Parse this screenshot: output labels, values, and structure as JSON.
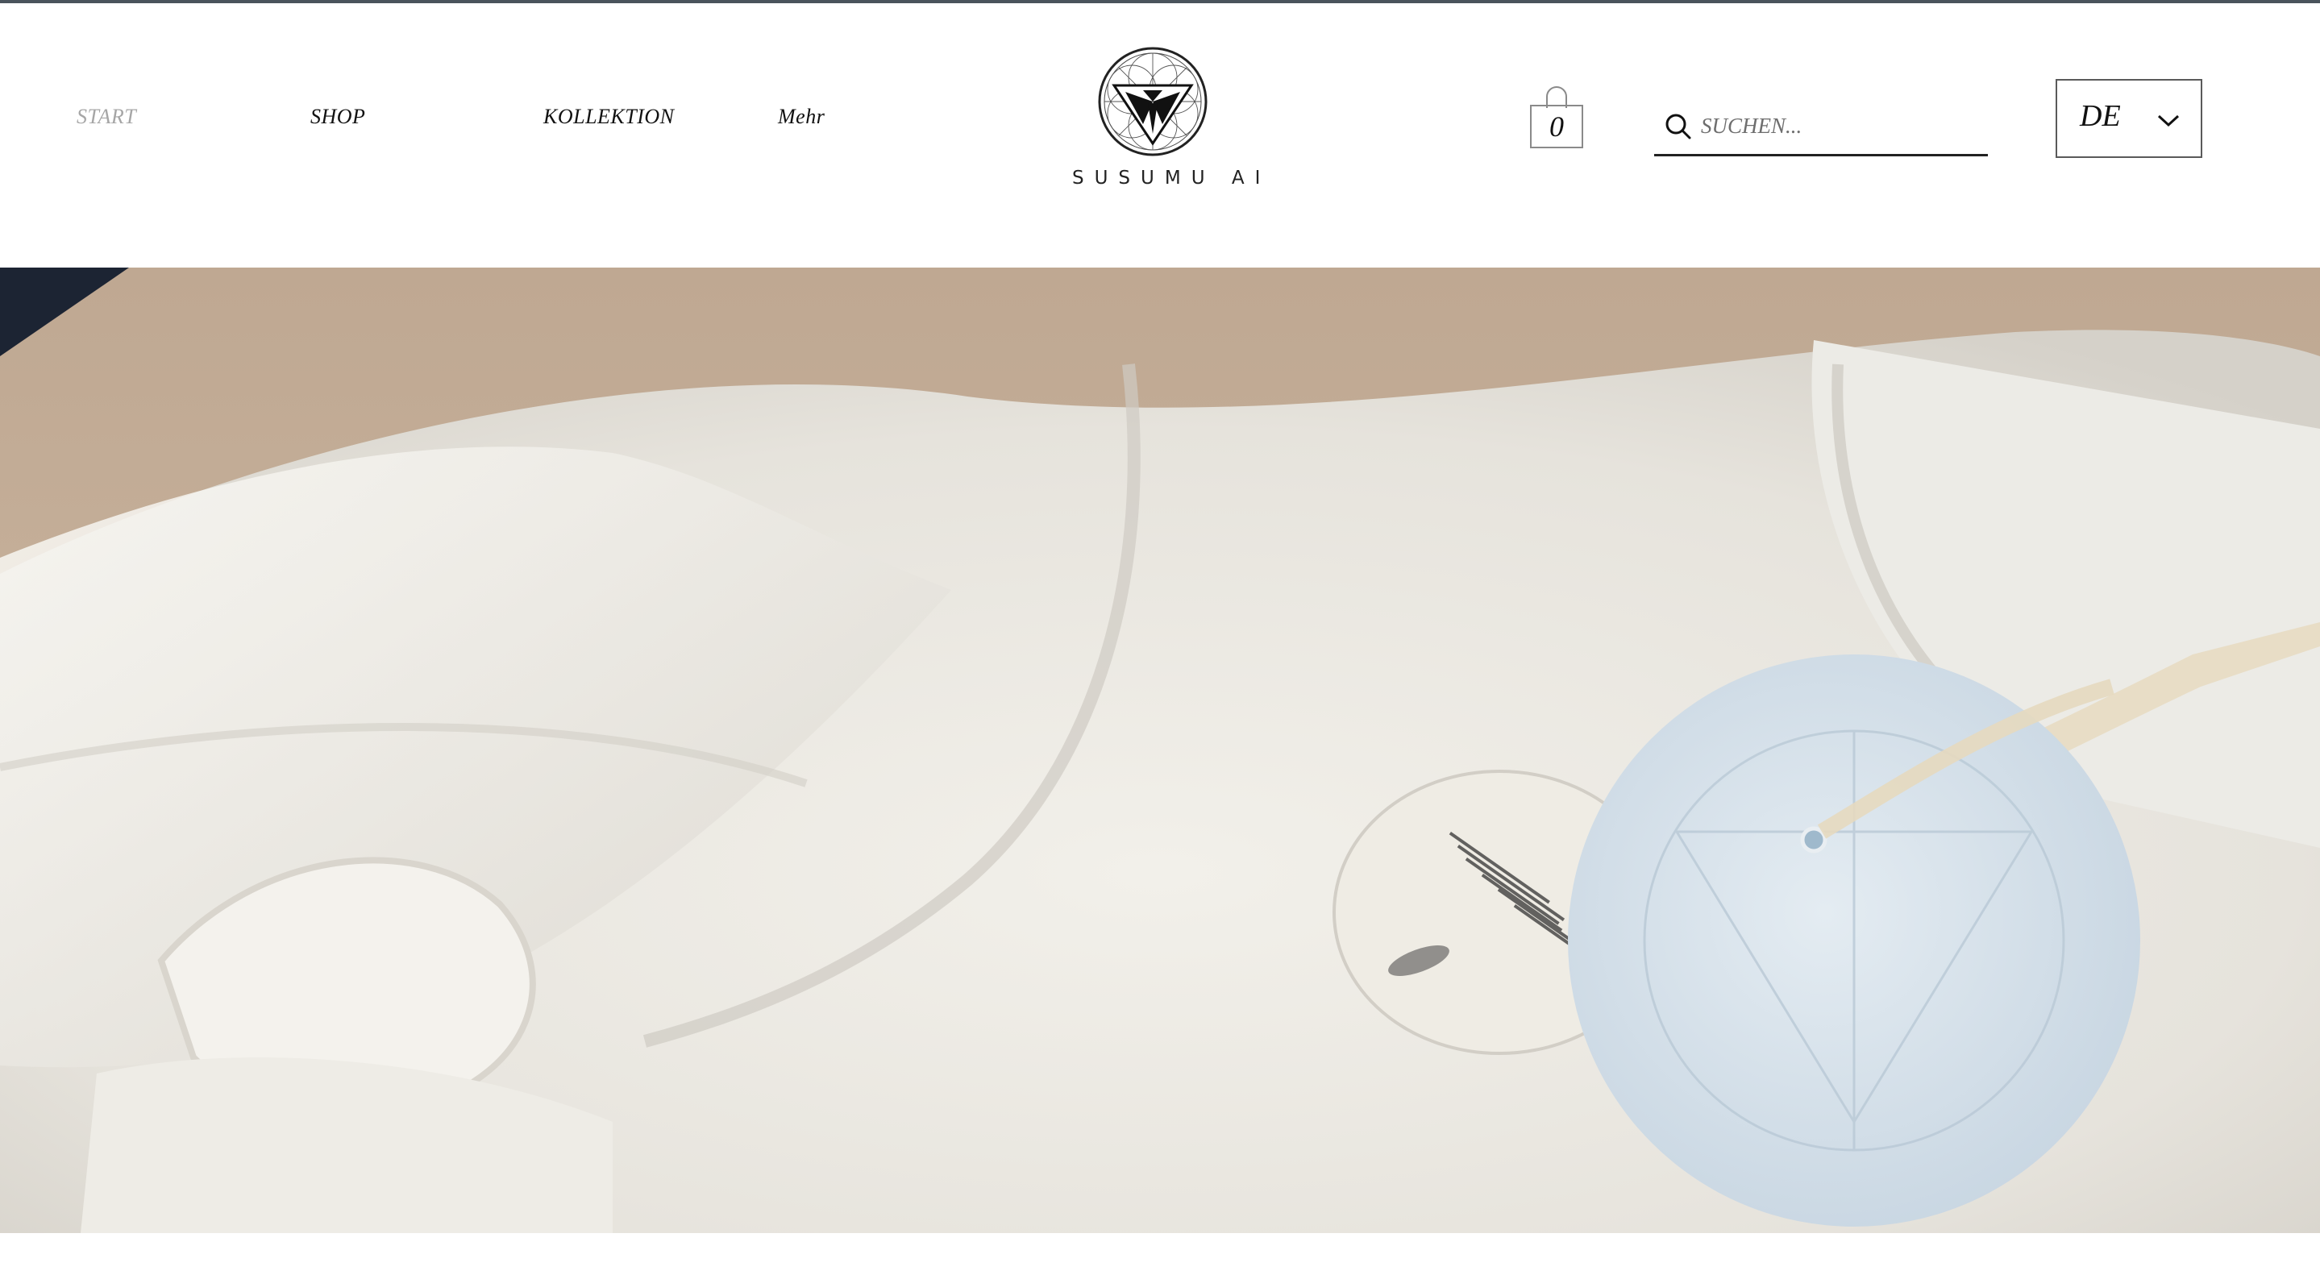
{
  "brand": {
    "name": "SUSUMU AI"
  },
  "nav": {
    "items": [
      {
        "label": "START",
        "active": true
      },
      {
        "label": "SHOP",
        "active": false
      },
      {
        "label": "KOLLEKTION",
        "active": false
      },
      {
        "label": "Mehr",
        "active": false
      }
    ]
  },
  "cart": {
    "count": "0",
    "icon": "shopping-bag-icon"
  },
  "search": {
    "placeholder": "SUCHEN...",
    "value": "",
    "icon": "search-icon"
  },
  "language": {
    "selected": "DE",
    "icon": "chevron-down-icon"
  },
  "hero": {
    "image": "white-garment-with-hang-tags-photo"
  },
  "colors": {
    "top_rule": "#4a545c",
    "nav_active": "#a6a6a6",
    "text": "#111111",
    "background": "#ffffff"
  }
}
